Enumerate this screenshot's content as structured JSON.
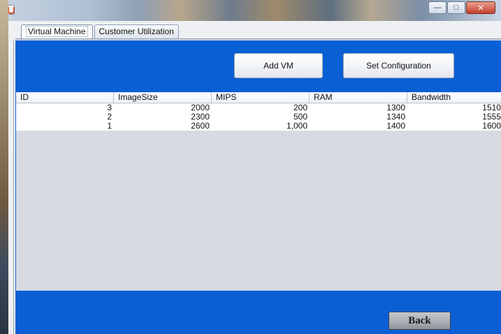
{
  "tabs": [
    {
      "label": "Virtual Machine",
      "active": true
    },
    {
      "label": "Customer Utilization",
      "active": false
    }
  ],
  "buttons": {
    "add_vm": "Add VM",
    "set_configuration": "Set Configuration",
    "back": "Back"
  },
  "table": {
    "columns": [
      "ID",
      "ImageSize",
      "MIPS",
      "RAM",
      "Bandwidth"
    ],
    "rows": [
      [
        "3",
        "2000",
        "200",
        "1300",
        "1510"
      ],
      [
        "2",
        "2300",
        "500",
        "1340",
        "1555"
      ],
      [
        "1",
        "2600",
        "1,000",
        "1400",
        "1600"
      ]
    ]
  },
  "colors": {
    "panel_blue": "#0b5fd4",
    "table_bg": "#d7dbe1"
  },
  "icons": [
    "java-icon",
    "minimize-icon",
    "maximize-icon",
    "close-icon"
  ]
}
